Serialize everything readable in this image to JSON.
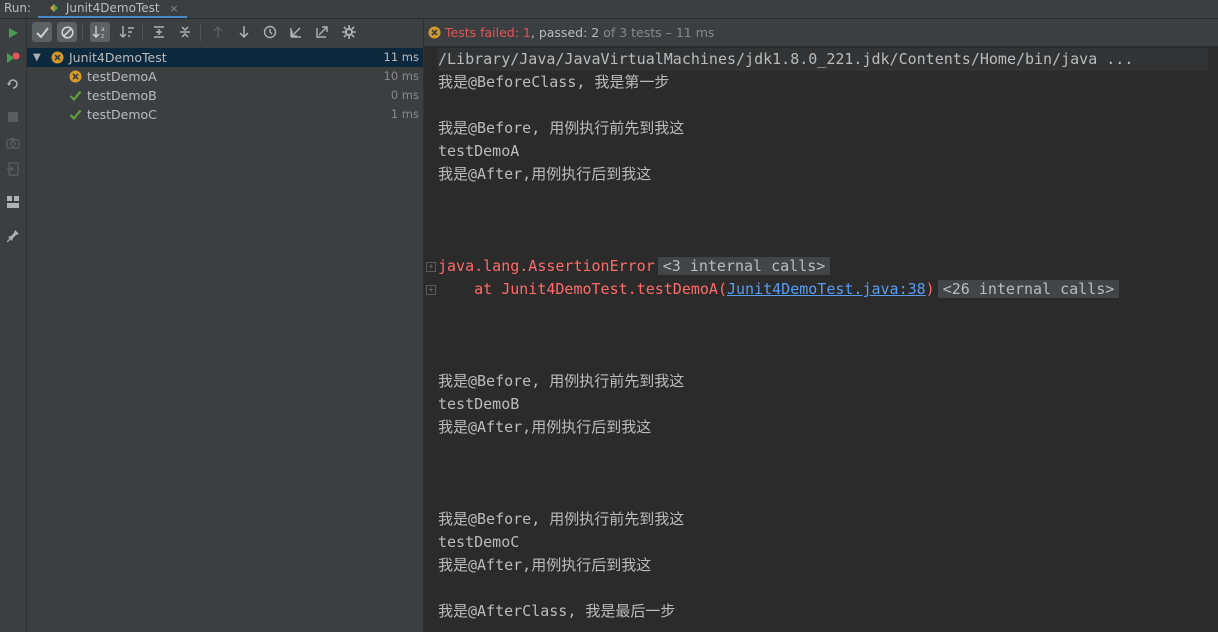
{
  "header": {
    "run_label": "Run:",
    "tab_label": "Junit4DemoTest",
    "tab_close": "×"
  },
  "vertical_toolbar": {
    "icons": [
      "rerun-icon",
      "rerun-failed-icon",
      "toggle-auto-test-icon",
      "stop-icon",
      "dump-threads-icon",
      "exit-icon",
      "layout-icon",
      "pin-icon"
    ]
  },
  "tree_toolbar": {
    "icons": [
      "show-passed-icon",
      "show-ignored-icon",
      "sort-alphabetically-icon",
      "sort-by-duration-icon",
      "expand-all-icon",
      "collapse-all-icon",
      "previous-failed-icon",
      "next-failed-icon",
      "test-history-icon",
      "import-tests-icon",
      "export-tests-icon",
      "settings-icon"
    ]
  },
  "tree": {
    "root": {
      "name": "Junit4DemoTest",
      "time": "11 ms",
      "status": "failed"
    },
    "children": [
      {
        "name": "testDemoA",
        "time": "10 ms",
        "status": "failed"
      },
      {
        "name": "testDemoB",
        "time": "0 ms",
        "status": "passed"
      },
      {
        "name": "testDemoC",
        "time": "1 ms",
        "status": "passed"
      }
    ]
  },
  "status": {
    "failed_label": "Tests failed: ",
    "failed_count": "1",
    "passed_label": ", passed: ",
    "passed_count": "2",
    "total_text": " of 3 tests – 11 ms"
  },
  "console": {
    "command_line": "/Library/Java/JavaVirtualMachines/jdk1.8.0_221.jdk/Contents/Home/bin/java ...",
    "lines": [
      "我是@BeforeClass, 我是第一步",
      "",
      "我是@Before, 用例执行前先到我这",
      "testDemoA",
      "我是@After,用例执行后到我这"
    ],
    "error_line": "java.lang.AssertionError",
    "error_internal": "<3 internal calls>",
    "stack_prefix": "    at Junit4DemoTest.testDemoA(",
    "stack_link": "Junit4DemoTest.java:38",
    "stack_suffix": ")",
    "stack_internal": "<26 internal calls>",
    "block_b": [
      "我是@Before, 用例执行前先到我这",
      "testDemoB",
      "我是@After,用例执行后到我这"
    ],
    "block_c": [
      "我是@Before, 用例执行前先到我这",
      "testDemoC",
      "我是@After,用例执行后到我这"
    ],
    "final_line": "我是@AfterClass, 我是最后一步"
  },
  "colors": {
    "failed": "#e05555",
    "passed": "#5f9e3e",
    "fail_icon": "#d29a2a",
    "link": "#589df6",
    "error_text": "#ff6b68"
  }
}
